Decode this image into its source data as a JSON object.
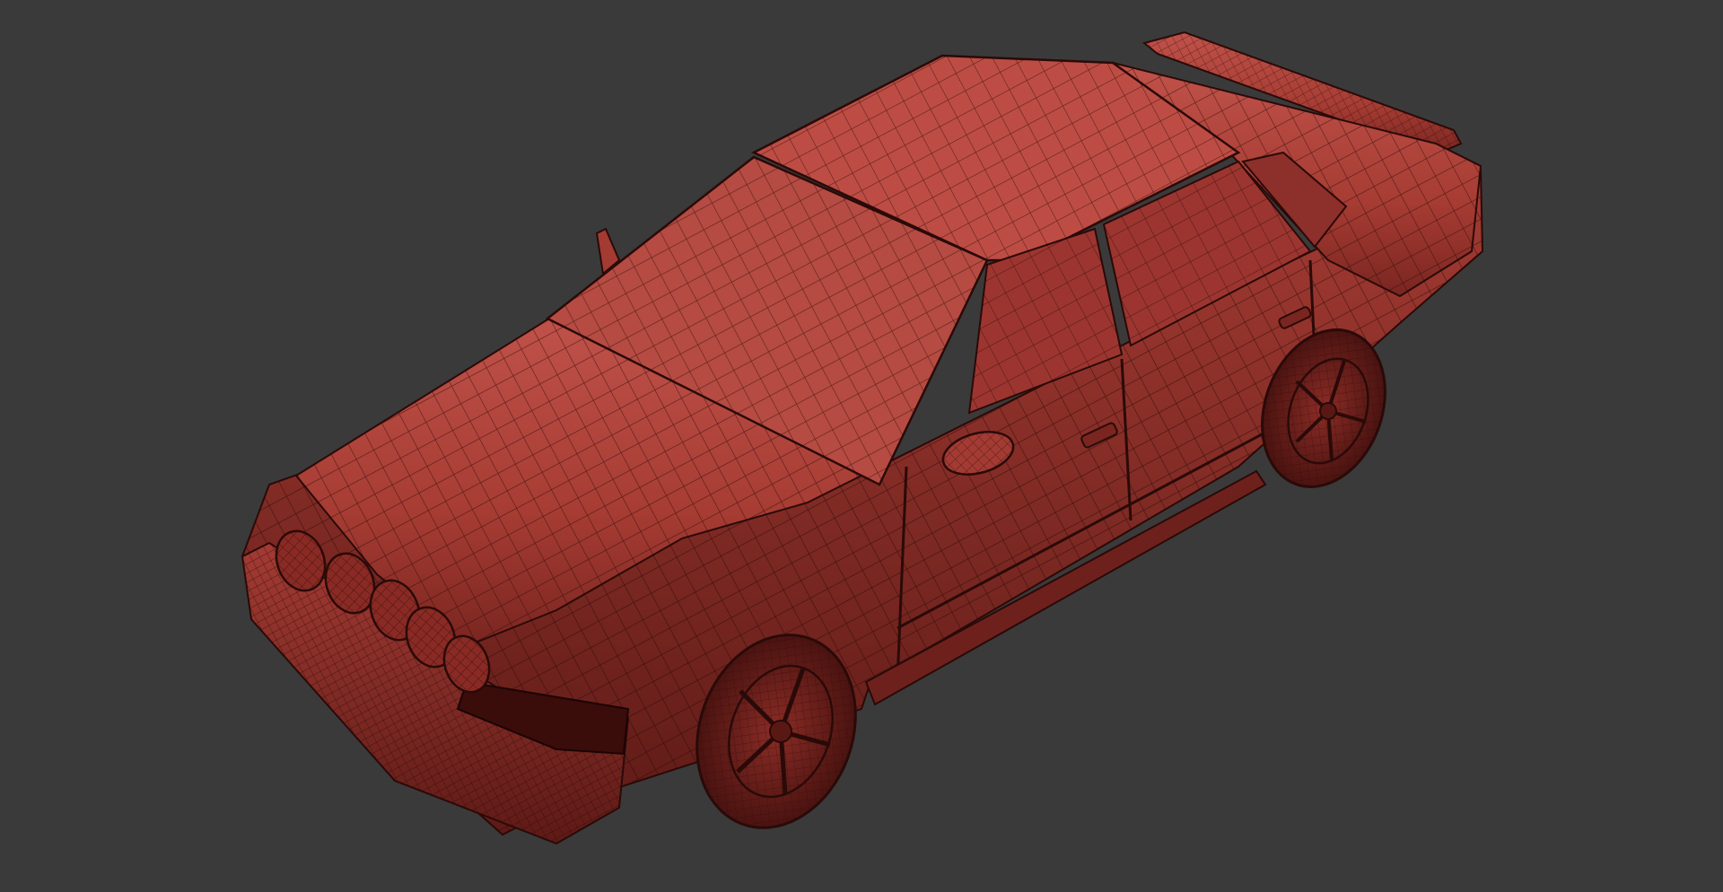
{
  "viewport": {
    "background_color": "#3a3a3a",
    "shading": "wireframe-on-shaded",
    "model_color": "#b5463c",
    "wire_color": "#2a0a08"
  },
  "model": {
    "subject": "sedan",
    "parts": [
      "hood",
      "windshield",
      "roof",
      "trunk",
      "rear-spoiler",
      "side-mirror",
      "front-door",
      "rear-door",
      "front-wheel",
      "rear-wheel",
      "headlight",
      "rally-lights",
      "front-bumper",
      "antenna"
    ],
    "rally_light_count": 5
  }
}
